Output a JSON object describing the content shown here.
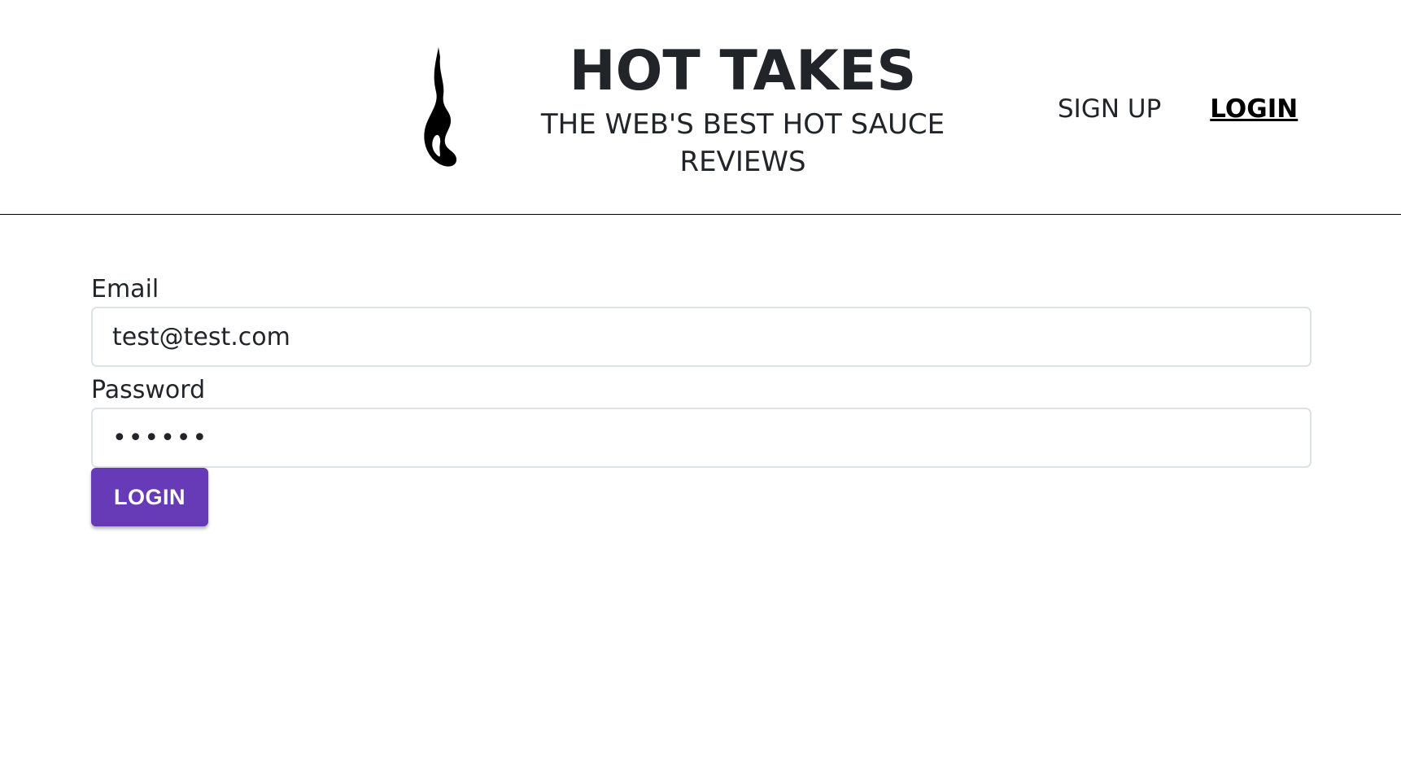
{
  "brand": {
    "title": "HOT TAKES",
    "subtitle": "THE WEB'S BEST HOT SAUCE REVIEWS",
    "logo_icon": "flame-icon"
  },
  "nav": {
    "signup_label": "SIGN UP",
    "login_label": "LOGIN",
    "active": "login"
  },
  "form": {
    "email_label": "Email",
    "email_value": "test@test.com",
    "password_label": "Password",
    "password_value": "••••••",
    "submit_label": "LOGIN"
  },
  "colors": {
    "accent": "#673ab7",
    "text": "#212529",
    "border": "#dee2e6"
  }
}
